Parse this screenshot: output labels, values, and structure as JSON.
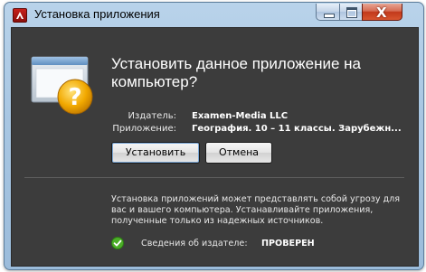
{
  "window": {
    "title": "Установка приложения",
    "icon": "adobe-air-icon"
  },
  "controls": {
    "minimize_icon": "minimize-icon",
    "maximize_icon": "maximize-icon",
    "close_icon": "close-icon",
    "close_glyph": "X"
  },
  "dialog": {
    "heading": "Установить данное приложение на компьютер?",
    "publisher_label": "Издатель:",
    "publisher_value": "Examen-Media LLC",
    "app_label": "Приложение:",
    "app_value": "География. 10 – 11 классы. Зарубежн...",
    "install_button": "Установить",
    "cancel_button": "Отмена",
    "warning_text": "Установка приложений может представлять собой угрозу для вас и вашего компьютера. Устанавливайте приложения, полученные только из надежных источников.",
    "verified_label": "Сведения об издателе:",
    "verified_value": "ПРОВЕРЕН",
    "illustration_icon": "question-window-icon",
    "verified_icon": "checkmark-icon"
  },
  "colors": {
    "content_bg": "#3c3c3c",
    "question_badge": "#f2a900",
    "verified_green": "#4caf28"
  }
}
